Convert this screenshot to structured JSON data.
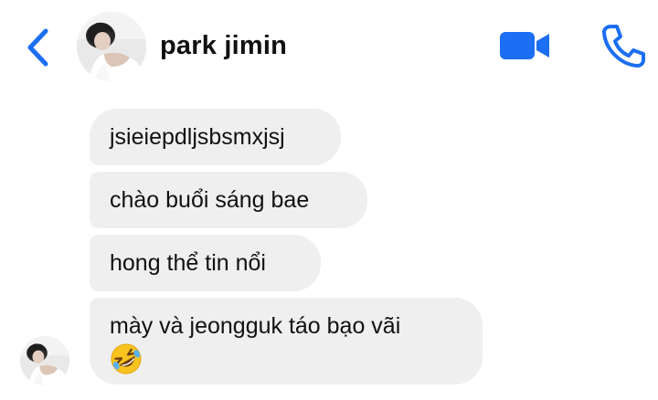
{
  "header": {
    "contact_name": "park jimin",
    "back_icon": "chevron-left-icon",
    "video_icon": "video-camera-icon",
    "call_icon": "phone-icon",
    "accent_color": "#1c6ef2"
  },
  "messages": [
    {
      "text": "jsieiepdljsbsmxjsj"
    },
    {
      "text": "chào buổi sáng bae"
    },
    {
      "text": "hong thể tin nổi"
    },
    {
      "text": "mày và jeongguk táo bạo vãi",
      "emoji": "rolling-on-floor-laughing-emoji"
    }
  ],
  "colors": {
    "bubble_bg": "#efefef",
    "text": "#111111",
    "background": "#ffffff"
  }
}
